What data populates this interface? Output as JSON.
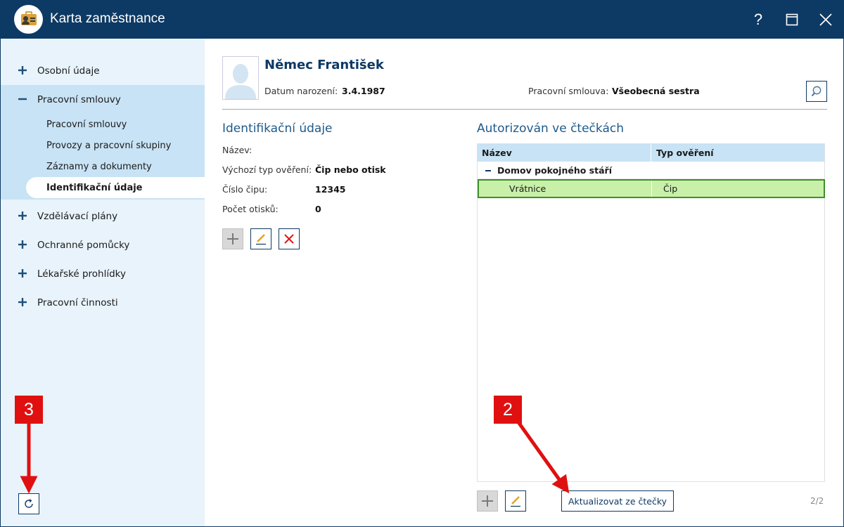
{
  "window": {
    "title": "Karta zaměstnance",
    "help": "?"
  },
  "sidebar": {
    "items": [
      {
        "label": "Osobní údaje",
        "expanded": false
      },
      {
        "label": "Pracovní smlouvy",
        "expanded": true
      },
      {
        "label": "Vzdělávací plány",
        "expanded": false
      },
      {
        "label": "Ochranné pomůcky",
        "expanded": false
      },
      {
        "label": "Lékařské prohlídky",
        "expanded": false
      },
      {
        "label": "Pracovní činnosti",
        "expanded": false
      }
    ],
    "subitems": [
      {
        "label": "Pracovní smlouvy",
        "active": false
      },
      {
        "label": "Provozy a pracovní skupiny",
        "active": false
      },
      {
        "label": "Záznamy a dokumenty",
        "active": false
      },
      {
        "label": "Identifikační údaje",
        "active": true
      }
    ]
  },
  "employee": {
    "name": "Němec František",
    "birth_label": "Datum narození:",
    "birth_value": "3.4.1987",
    "contract_label": "Pracovní smlouva:",
    "contract_value": "Všeobecná sestra"
  },
  "identification": {
    "title": "Identifikační údaje",
    "fields": [
      {
        "label": "Název:",
        "value": ""
      },
      {
        "label": "Výchozí typ ověření:",
        "value": "Čip nebo otisk"
      },
      {
        "label": "Číslo čipu:",
        "value": "12345"
      },
      {
        "label": "Počet otisků:",
        "value": "0"
      }
    ]
  },
  "readers": {
    "title": "Autorizován ve čtečkách",
    "columns": [
      "Název",
      "Typ ověření"
    ],
    "group": "Domov pokojného stáří",
    "rows": [
      {
        "name": "Vrátnice",
        "type": "Čip"
      }
    ],
    "update_button": "Aktualizovat ze čtečky",
    "pager": "2/2"
  },
  "annotations": {
    "badge_2": "2",
    "badge_3": "3",
    "color": "#e01010"
  },
  "colors": {
    "titlebar": "#0d3a64",
    "sidebar_bg": "#e8f3fb",
    "sidebar_open_bg": "#c8e3f5",
    "selected_row": "#c8f0a8",
    "accent_text": "#1e5a8a"
  }
}
